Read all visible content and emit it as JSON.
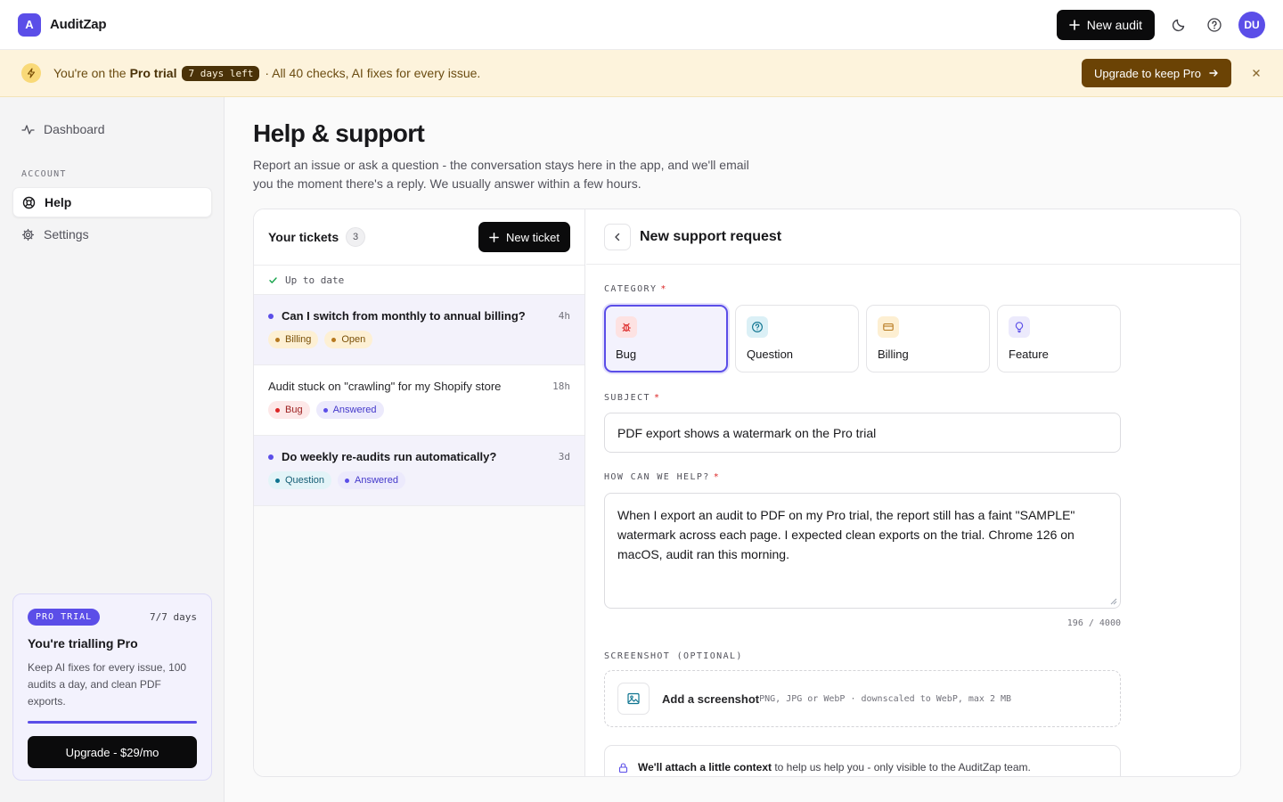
{
  "app": {
    "logo_letter": "A",
    "name": "AuditZap"
  },
  "topbar": {
    "new_audit_label": "New audit",
    "avatar_initials": "DU"
  },
  "banner": {
    "text_prefix": "You're on the",
    "plan": "Pro trial",
    "days_left": "7 days left",
    "text_suffix": "· All 40 checks, AI fixes for every issue.",
    "upgrade_label": "Upgrade to keep Pro"
  },
  "sidebar": {
    "dashboard_label": "Dashboard",
    "section_label": "ACCOUNT",
    "help_label": "Help",
    "settings_label": "Settings",
    "trial": {
      "badge": "PRO TRIAL",
      "days": "7/7 days",
      "title": "You're trialling Pro",
      "description": "Keep AI fixes for every issue, 100 audits a day, and clean PDF exports.",
      "progress": 1.0,
      "button_label": "Upgrade - $29/mo"
    }
  },
  "page": {
    "title": "Help & support",
    "subtitle": "Report an issue or ask a question - the conversation stays here in the app, and we'll email you the moment there's a reply. We usually answer within a few hours."
  },
  "tickets": {
    "title": "Your tickets",
    "count": "3",
    "new_ticket_label": "New ticket",
    "sync_status": "Up to date",
    "items": [
      {
        "subject": "Can I switch from monthly to annual billing?",
        "time": "4h",
        "tags": [
          {
            "label": "Billing",
            "bg": "#fdf0d4",
            "fg": "#7a4f07",
            "dot": "#b7791f"
          },
          {
            "label": "Open",
            "bg": "#fdf0d4",
            "fg": "#7a4f07",
            "dot": "#b7791f"
          }
        ]
      },
      {
        "subject": "Audit stuck on \"crawling\" for my Shopify store",
        "time": "18h",
        "tags": [
          {
            "label": "Bug",
            "bg": "#fde8e8",
            "fg": "#9b1c1c",
            "dot": "#dc2626"
          },
          {
            "label": "Answered",
            "bg": "#eceafc",
            "fg": "#4338ca",
            "dot": "#5b4ee8"
          }
        ]
      },
      {
        "subject": "Do weekly re-audits run automatically?",
        "time": "3d",
        "tags": [
          {
            "label": "Question",
            "bg": "#e3f4f8",
            "fg": "#155e75",
            "dot": "#0e7490"
          },
          {
            "label": "Answered",
            "bg": "#eceafc",
            "fg": "#4338ca",
            "dot": "#5b4ee8"
          }
        ]
      }
    ]
  },
  "form": {
    "title": "New support request",
    "category_label": "CATEGORY",
    "categories": [
      "Bug",
      "Question",
      "Billing",
      "Feature"
    ],
    "selected_category": "Bug",
    "subject_label": "SUBJECT",
    "subject_value": "PDF export shows a watermark on the Pro trial",
    "message_label": "HOW CAN WE HELP?",
    "message_value": "When I export an audit to PDF on my Pro trial, the report still has a faint \"SAMPLE\" watermark across each page. I expected clean exports on the trial. Chrome 126 on macOS, audit ran this morning.",
    "char_count": "196 / 4000",
    "screenshot_label": "SCREENSHOT (OPTIONAL)",
    "upload_title": "Add a screenshot",
    "upload_hint": "PNG, JPG or WebP · downscaled to WebP, max 2 MB",
    "context_bold": "We'll attach a little context",
    "context_rest": "to help us help you - only visible to the AuditZap team.",
    "required_mark": "*"
  },
  "colors": {
    "accent": "#5b4ee8",
    "banner_bg": "#fdf3dc",
    "upgrade_btn": "#6b4305"
  }
}
